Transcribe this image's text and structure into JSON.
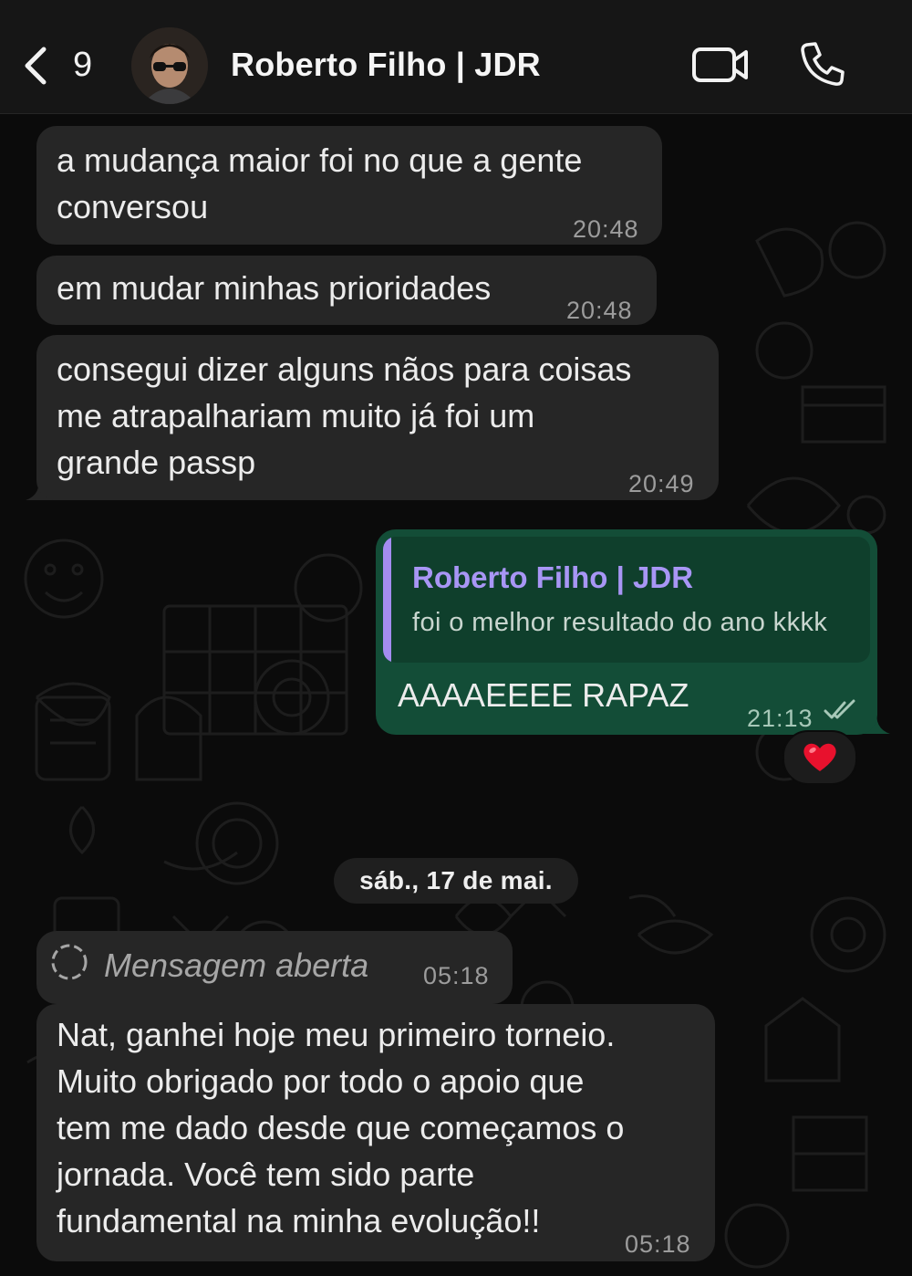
{
  "header": {
    "back_count": "9",
    "contact_name": "Roberto Filho | JDR",
    "video_icon": "video-camera-icon",
    "call_icon": "phone-icon"
  },
  "messages": [
    {
      "direction": "in",
      "text_lines": [
        "a mudança maior foi no que a gente",
        "conversou"
      ],
      "time": "20:48"
    },
    {
      "direction": "in",
      "text_lines": [
        "em mudar minhas prioridades"
      ],
      "time": "20:48"
    },
    {
      "direction": "in",
      "text_lines": [
        "consegui dizer alguns nãos para coisas",
        "me atrapalhariam muito já foi um",
        "grande passp"
      ],
      "time": "20:49"
    },
    {
      "direction": "out",
      "quoted": {
        "author": "Roberto Filho | JDR",
        "text": "foi o melhor resultado do ano kkkk"
      },
      "text_lines": [
        "AAAAEEEE RAPAZ"
      ],
      "time": "21:13",
      "status": "read",
      "reaction": "❤️"
    }
  ],
  "date_separator": "sáb., 17 de mai.",
  "messages_after": [
    {
      "direction": "in",
      "type": "view-once",
      "text": "Mensagem aberta",
      "time": "05:18"
    },
    {
      "direction": "in",
      "text_lines": [
        "Nat, ganhei hoje meu primeiro torneio.",
        "Muito obrigado por todo o apoio que",
        "tem me dado desde que começamos o",
        "jornada. Você tem sido parte",
        "fundamental na minha evolução!!"
      ],
      "time": "05:18"
    }
  ],
  "colors": {
    "background": "#0b0b0b",
    "incoming_bubble": "#262626",
    "outgoing_bubble": "#134d37",
    "quote_accent": "#a48cf0"
  }
}
